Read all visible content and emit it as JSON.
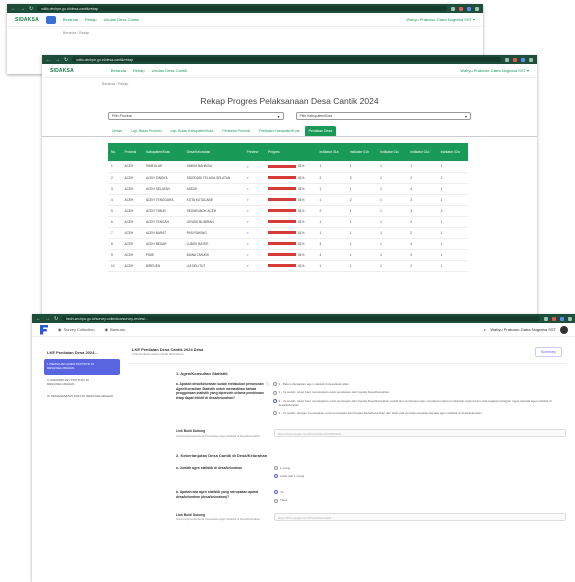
{
  "window1": {
    "url": "sdkb.dechpe.go.id/desa-cantik/rekap",
    "logo": "SIDAKSA",
    "menu": [
      "Beranda",
      "Rekap",
      "Usulan Desa Cantik"
    ],
    "user": "Wahyu Prabowo Gatra Nugraha SST ▾"
  },
  "window2": {
    "url": "sdkb.dechpe.go.id/desa-cantik/rekap",
    "logo": "SIDAKSA",
    "menu": [
      "Beranda",
      "Rekap",
      "Usulan Desa Cantik"
    ],
    "user": "Wahyu Prabowo Gatra Nugraha SST ▾",
    "breadcrumb": "Beranda  /  Rekap",
    "title": "Rekap Progres Pelaksanaan Desa Cantik 2024",
    "select_provinsi": "Pilih Provinsi",
    "select_kabkota": "Pilih Kabupaten/Kota",
    "tabs": [
      "Umum",
      "Lap. Bulan Provinsi",
      "Lap. Bulan Kabupaten/Kota",
      "Penilaian Provinsi",
      "Penilaian Kabupaten/Kota",
      "Penilaian Desa"
    ],
    "active_tab": 5,
    "columns": [
      "No.",
      "Provinsi",
      "Kabupaten/Kota",
      "Desa/Kelurahan",
      "Preview",
      "Progres",
      "Indikator 01a",
      "Indikator 01b",
      "Indikator 01c",
      "Indikator 01d",
      "Indikator 02a"
    ],
    "rows": [
      [
        "1",
        "ACEH",
        "SIMEULUE",
        "AIMEM BAHAGIA",
        "81%",
        "1",
        "1",
        "1",
        "1",
        "1"
      ],
      [
        "2",
        "ACEH",
        "ACEH SINGKIL",
        "SIDODADI TELAGA SELATAN",
        "81%",
        "2",
        "3",
        "1",
        "2",
        "2"
      ],
      [
        "3",
        "ACEH",
        "ACEH SELATAN",
        "ASEUK",
        "81%",
        "1",
        "1",
        "1",
        "4",
        "1"
      ],
      [
        "4",
        "ACEH",
        "ACEH TENGGARA",
        "KOTA KUTACANE",
        "81%",
        "1",
        "2",
        "1",
        "2",
        "1"
      ],
      [
        "5",
        "ACEH",
        "ACEH TIMUR",
        "SEUNEUBOK ACEH",
        "81%",
        "2",
        "1",
        "1",
        "3",
        "2"
      ],
      [
        "6",
        "ACEH",
        "ACEH TENGAH",
        "LENGKI BLIBIRAN",
        "81%",
        "1",
        "1",
        "1",
        "2",
        "1"
      ],
      [
        "7",
        "ACEH",
        "ACEH BARAT",
        "PASI RAKING",
        "81%",
        "1",
        "1",
        "1",
        "2",
        "1"
      ],
      [
        "8",
        "ACEH",
        "ACEH BESAR",
        "LUBOK BATEE",
        "81%",
        "4",
        "1",
        "1",
        "4",
        "1"
      ],
      [
        "9",
        "ACEH",
        "PIDIE",
        "BIANA TANJOK",
        "81%",
        "4",
        "1",
        "1",
        "2",
        "1"
      ],
      [
        "10",
        "ACEH",
        "BIREUEN",
        "LIA DELITUT",
        "81%",
        "1",
        "1",
        "1",
        "2",
        "1"
      ]
    ]
  },
  "window3": {
    "url": "fasih-sm.bps.go.id/survey-collection/survey-review/...",
    "menu_survey": "Survey Collection",
    "menu_bantuan": "Bantuan",
    "user": "Wahyu Prabowo Gatra Nugraha SST",
    "sidebar_title": "LKE Penilaian Desa 2024...",
    "sidebar_items": [
      "I. PEMILIHAN AGEN STATISTIK DI DESA/KELURAHAN",
      "II. KEMAMPUAN STATISTIK DI DESA/KELURAHAN",
      "III. PEMANFAATAN DATA DI DESA/KELURAHAN"
    ],
    "survey_title": "LKE Penilaian Desa Cantik 2024 Desa",
    "survey_subtitle": "LKE Penilaian Desa Cantik 2024 Desa",
    "summary_label": "Summary",
    "section1": "1. Agen/Konsultan Statistik",
    "q1_label": "a. Apakah desa/kelurahan sudah melakukan perumusan Agen/Konsultan Statistik untuk memastikan bahwa penggunaan statistik yang diperoleh selama pembinaan tetap dapat efektif di desa/kelurahan?",
    "q1_options": [
      "0 - Belum ditetapkan agen statistik di desa/kelurahan",
      "1 - Ya sudah, tetapi baru menetapkan surat penetapan dari Kepala Desa/Kelurahan",
      "2 - Ya sudah, tetapi baru menetapkan surat penetapan dari Kepala Desa/Kelurahan sudah ikut pembinaan dan mendapat materi pembinaan tetapi belum ada tugas/pembagian tugas kepada agen statistik di desa/kelurahan",
      "3 - Ya sudah, dengan menetapkan surat penetapan dari Kepala Desa/Kelurahan dan telah ada peran/penugasan kepada agen statistik di desa/kelurahan"
    ],
    "q1_selected": 2,
    "link_label": "Link Bukti Dukung",
    "link_hint": "Surat Keputusan/Surat Penetapan Agen Statistik di Desa/Kelurahan",
    "link_value": "https://drive.google.com/drive/folders/1C9-8sKiENJ...",
    "section2": "2. Keberlanjutan Desa Cantik di Desa/Kelurahan",
    "q2_label": "a. Jumlah agen statistik di desa/kelurahan",
    "q2_options": [
      "1 orang",
      "Lebih dari 1 orang"
    ],
    "q2_selected": 1,
    "q3_label": "b. Apakah ada agen statistik yang merupakan aparat desa/kelurahan (desa/kelurahan)?",
    "q3_options": [
      "Ya",
      "Tidak"
    ],
    "q3_selected": 0,
    "link2_label": "Link Bukti Dukung",
    "link2_hint": "Surat Keputusan/Surat Penetapan Agen Statistik di Desa/Kelurahan",
    "link2_value": "https://drive.google.com/drive/folders/1aP6..."
  }
}
